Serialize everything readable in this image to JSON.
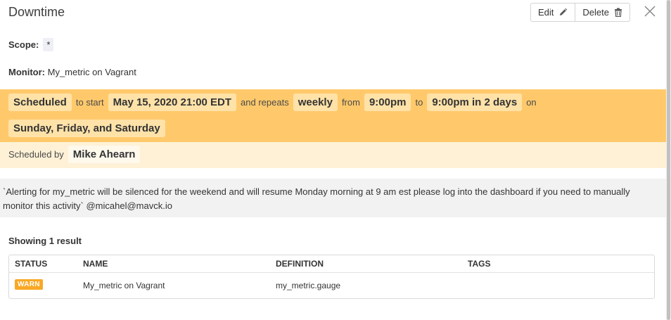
{
  "header": {
    "title": "Downtime",
    "edit_label": "Edit",
    "delete_label": "Delete"
  },
  "meta": {
    "scope_label": "Scope:",
    "scope_value": "*",
    "monitor_label": "Monitor:",
    "monitor_value": "My_metric on Vagrant"
  },
  "schedule": {
    "status": "Scheduled",
    "to_start": "to start",
    "start_date": "May 15, 2020 21:00 EDT",
    "and_repeats": "and repeats",
    "frequency": "weekly",
    "from": "from",
    "from_time": "9:00pm",
    "to": "to",
    "to_time": "9:00pm in 2 days",
    "on": "on",
    "days": "Sunday, Friday, and Saturday"
  },
  "scheduled_by": {
    "label": "Scheduled by",
    "name": "Mike Ahearn"
  },
  "message": "`Alerting for my_metric will be silenced for the weekend and will resume Monday morning at 9 am est please log into the dashboard if you need to manually monitor this activity` @micahel@mavck.io",
  "results": {
    "label": "Showing 1 result",
    "columns": [
      "STATUS",
      "NAME",
      "DEFINITION",
      "TAGS"
    ],
    "rows": [
      {
        "status": "WARN",
        "name": "My_metric on Vagrant",
        "definition": "my_metric.gauge",
        "tags": ""
      }
    ]
  },
  "colors": {
    "schedule_band": "#ffc96b",
    "scheduled_by_band": "#fef1d6",
    "warn": "#f9a825"
  }
}
